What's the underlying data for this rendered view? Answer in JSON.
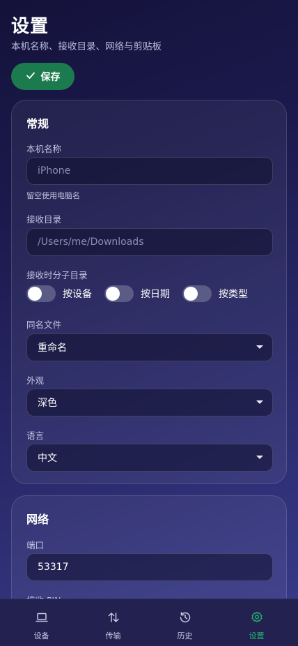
{
  "header": {
    "title": "设置",
    "subtitle": "本机名称、接收目录、网络与剪贴板"
  },
  "toolbar": {
    "save_label": "保存"
  },
  "general": {
    "title": "常规",
    "device_name": {
      "label": "本机名称",
      "placeholder": "iPhone",
      "hint": "留空使用电脑名"
    },
    "receive_dir": {
      "label": "接收目录",
      "placeholder": "/Users/me/Downloads"
    },
    "subdir": {
      "label": "接收时分子目录",
      "options": [
        {
          "label": "按设备",
          "enabled": false
        },
        {
          "label": "按日期",
          "enabled": false
        },
        {
          "label": "按类型",
          "enabled": false
        }
      ]
    },
    "same_name": {
      "label": "同名文件",
      "value": "重命名"
    },
    "appearance": {
      "label": "外观",
      "value": "深色"
    },
    "language": {
      "label": "语言",
      "value": "中文"
    }
  },
  "network": {
    "title": "网络",
    "port": {
      "label": "端口",
      "value": "53317"
    },
    "pin": {
      "label": "接收 PIN"
    }
  },
  "tabs": [
    {
      "label": "设备",
      "icon": "laptop-icon",
      "active": false
    },
    {
      "label": "传输",
      "icon": "transfer-arrows-icon",
      "active": false
    },
    {
      "label": "历史",
      "icon": "history-icon",
      "active": false
    },
    {
      "label": "设置",
      "icon": "gear-icon",
      "active": true
    }
  ],
  "colors": {
    "accent": "#1c7a4f",
    "active_tab": "#24b46e"
  }
}
